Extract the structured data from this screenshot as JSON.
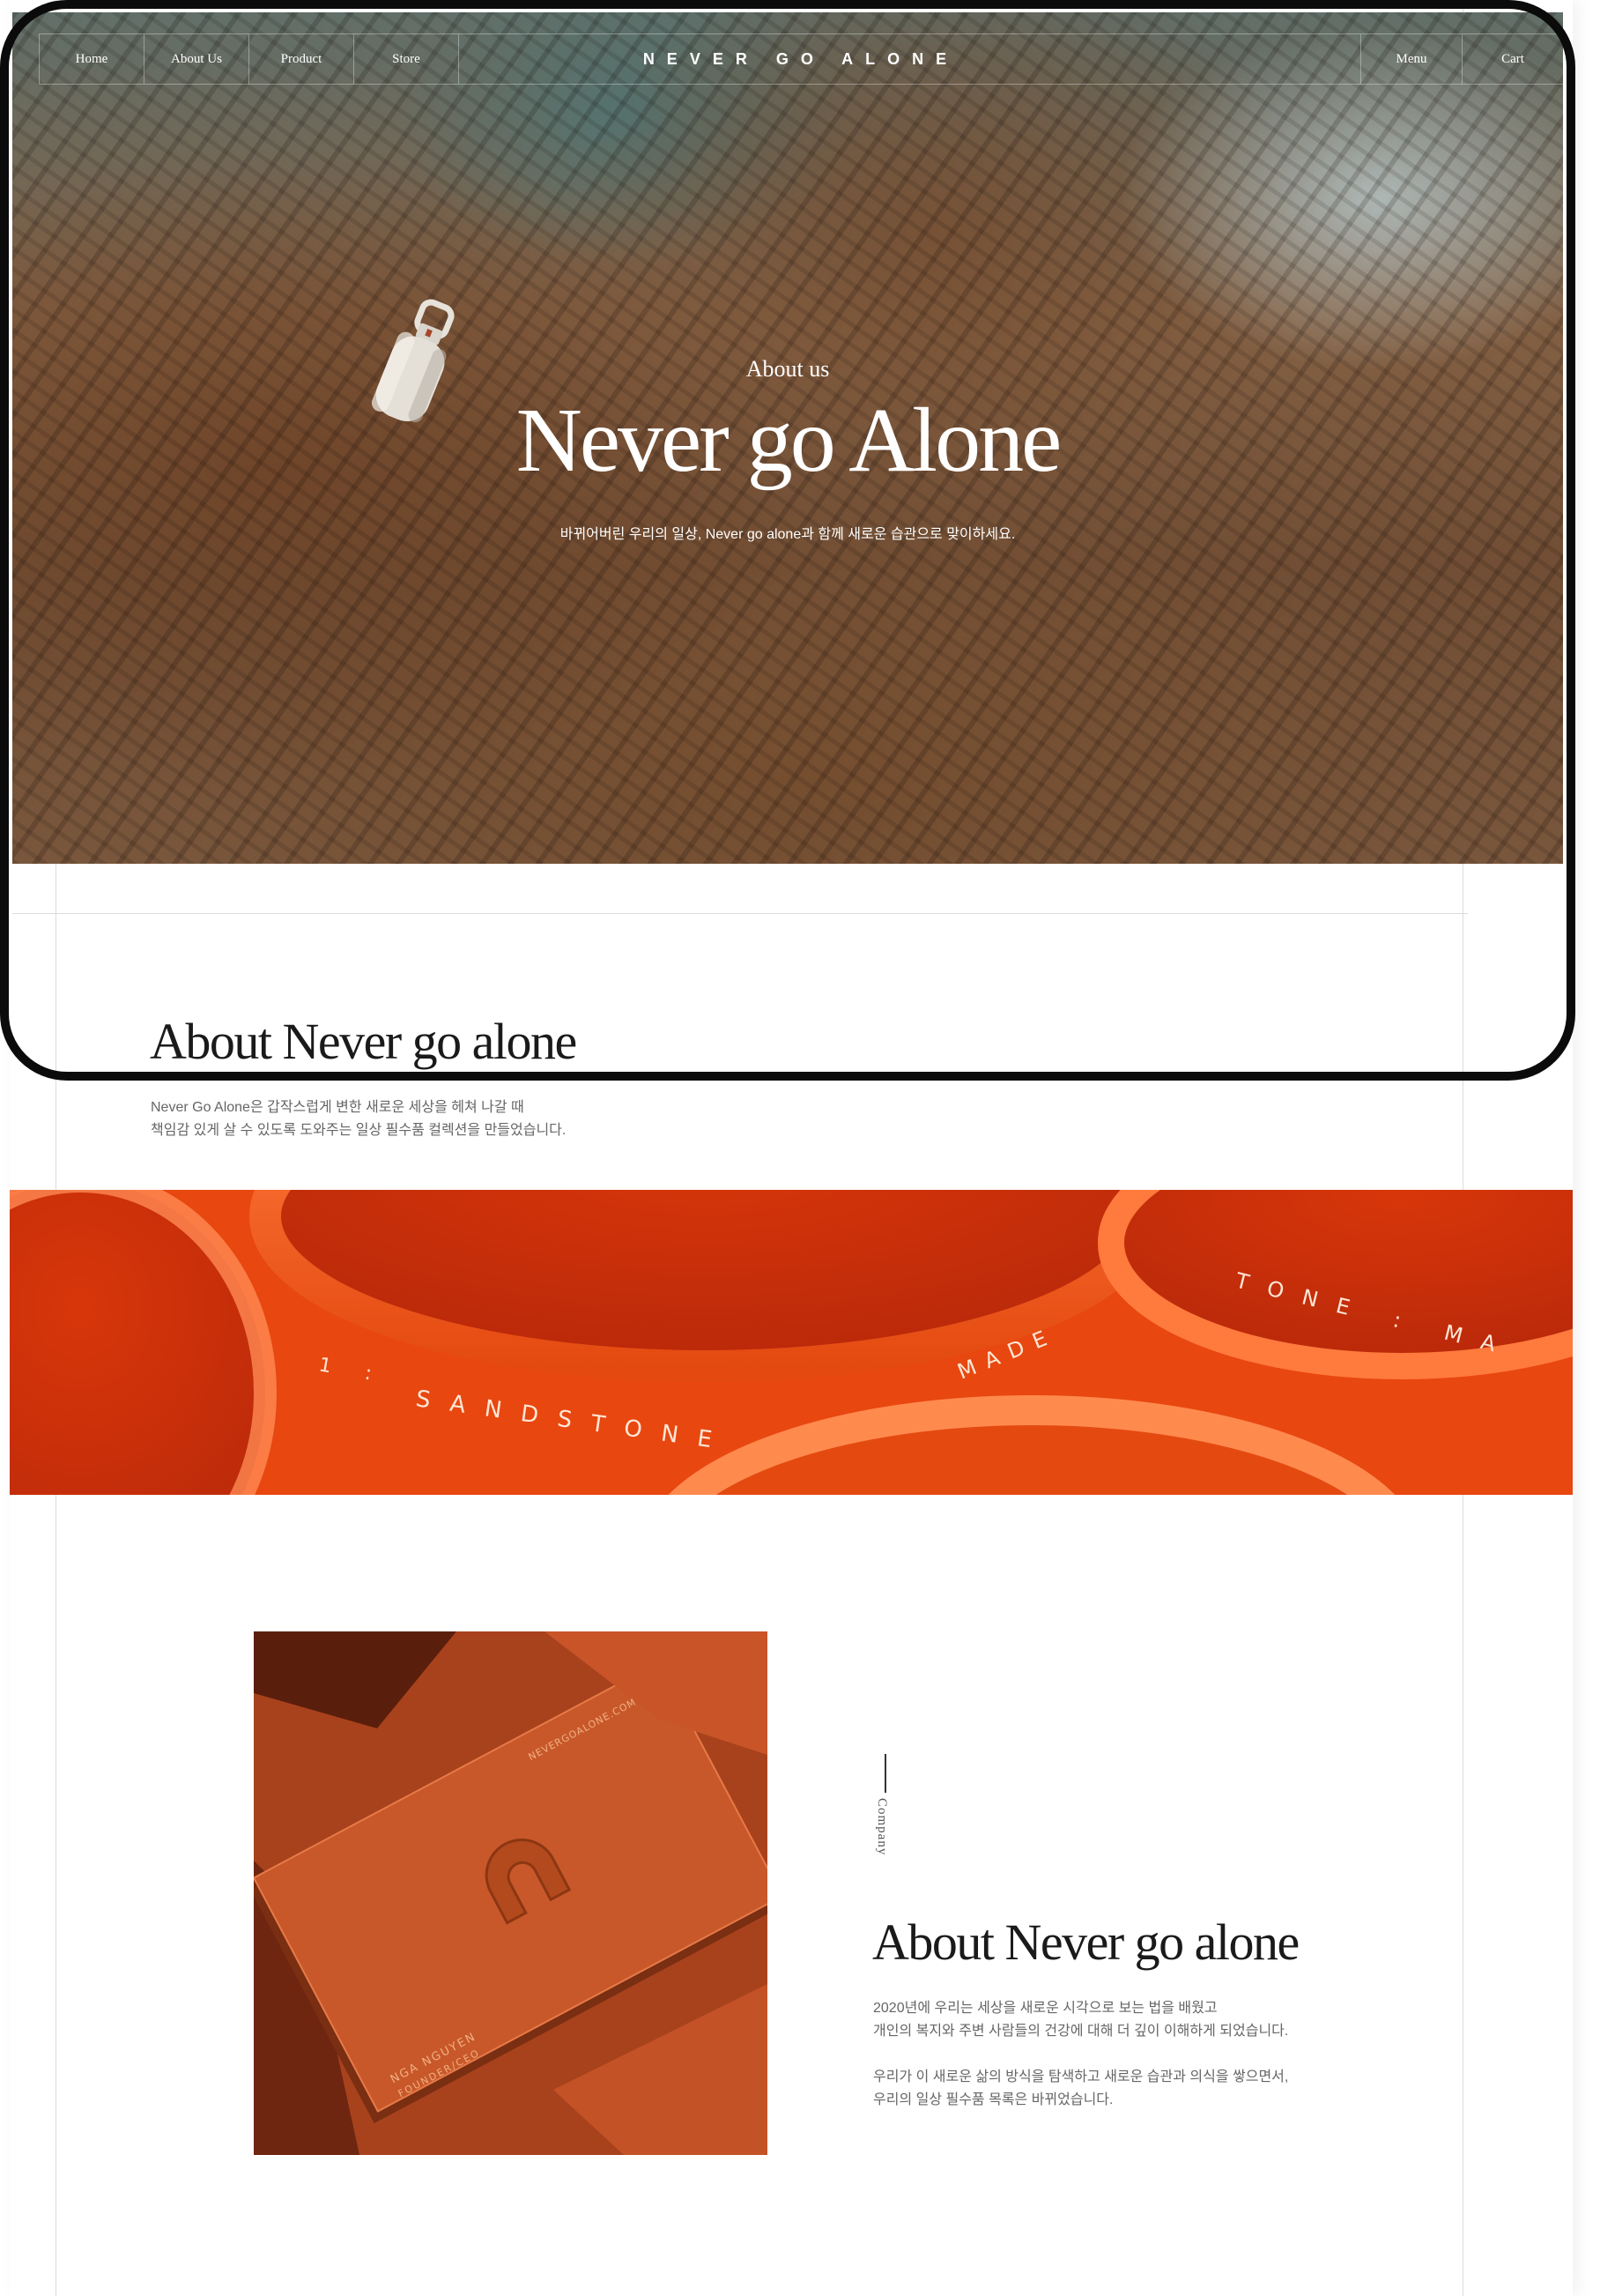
{
  "nav": {
    "left_items": [
      "Home",
      "About Us",
      "Product",
      "Store"
    ],
    "brand": "NEVER GO ALONE",
    "right_items": [
      "Menu",
      "Cart"
    ]
  },
  "hero": {
    "subtitle": "About us",
    "title": "Never go Alone",
    "description": "바뀌어버린 우리의 일상, Never go alone과 함께 새로운 습관으로 맞이하세요."
  },
  "about_section": {
    "title": "About Never go alone",
    "lines": [
      "Never Go Alone은 갑작스럽게 변한 새로운 세상을 헤쳐 나갈 때",
      "책임감 있게 살 수 있도록 도와주는 일상 필수품 컬렉션을 만들었습니다."
    ]
  },
  "band_lettering": {
    "text_1": "SANDSTONE",
    "text_2": "MADE",
    "text_3": "TONE : MA",
    "text_4": "1 :"
  },
  "card_image": {
    "card_name": "NGA NGUYEN",
    "card_role": "FOUNDER/CEO",
    "card_site": "NEVERGOALONE.COM"
  },
  "company_section": {
    "label": "Company",
    "title": "About Never go alone",
    "paragraph_1": [
      "2020년에 우리는 세상을 새로운 시각으로 보는 법을 배웠고",
      "개인의 복지와 주변 사람들의 건강에 대해 더 깊이 이해하게 되었습니다."
    ],
    "paragraph_2": [
      "우리가 이 새로운 삶의 방식을 탐색하고 새로운 습관과 의식을 쌓으면서,",
      "우리의 일상 필수품 목록은 바뀌었습니다."
    ]
  },
  "colors": {
    "accent_orange": "#ec4a10",
    "card_orange": "#b84a22",
    "frame_black": "#0b0b0b"
  }
}
